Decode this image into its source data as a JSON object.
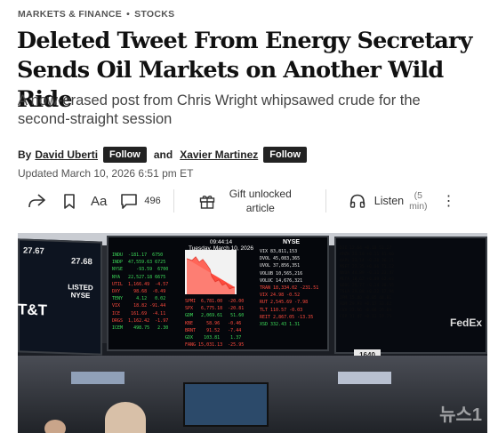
{
  "breadcrumb": {
    "section": "MARKETS & FINANCE",
    "separator": "•",
    "subsection": "STOCKS"
  },
  "headline": "Deleted Tweet From Energy Secretary Sends Oil Markets on Another Wild Ride",
  "dek": "A now-erased post from Chris Wright whipsawed crude for the second-straight session",
  "byline": {
    "by": "By",
    "author1": "David Uberti",
    "follow1": "Follow",
    "and": "and",
    "author2": "Xavier Martinez",
    "follow2": "Follow"
  },
  "updated": "Updated March 10, 2026 6:51 pm ET",
  "toolbar": {
    "aa": "Aa",
    "comments": "496",
    "gift_line1": "Gift unlocked",
    "gift_line2": "article",
    "listen": "Listen",
    "duration_line1": "(5",
    "duration_line2": "min)",
    "more": "⋮"
  },
  "photo": {
    "left_screen_top": "27.67",
    "left_screen_top2": "27.68",
    "left_screen_brand": "LISTED NYSE",
    "left_screen_logo": "T&T",
    "board_time": "09:44:14",
    "board_date": "Tuesday, March 10, 2026",
    "board_exchange": "NYSE",
    "board_left_rows": [
      "INDU  -181.17  6750",
      "INDP  47,559.63 6725",
      "NYSE     -93.59  6700",
      "NYA   22,527.18 6675",
      "UTIL  1,166.49  -4.57",
      "DXY     98.68  -0.49",
      "TENY     4.12   0.02",
      "VIX     18.82 -91.44",
      "ICE    161.69  -4.11",
      "DRGS  1,162.42  -1.97",
      "ICEM    498.75   2.30"
    ],
    "board_right_rows": [
      "VIX      83,811,153",
      "DVOL     45,083,365",
      "UVOL     37,856,351",
      "VOLUB    10,565,216",
      "VOLUC    14,676,321",
      "TRAN  18,334.02 -231.51",
      "VIX      24.98  -0.52",
      "RUT   2,545.69  -7.98",
      "TLT     110.57  -0.03",
      "REIT  2,867.05 -13.35",
      "XSD     332.43   1.31"
    ],
    "board_mid_rows": [
      "SPMI  6,781.00  -20.00",
      "SPX   6,775.18  -20.81",
      "GDM   2,069.61   51.60",
      "KBE     58.96   -0.46",
      "BRNT    91.52   -7.44",
      "GDX    103.81    1.37",
      "FANG 15,031.13  -25.95"
    ],
    "board_far_right_rows": [
      "DJI  12.64 +0.18 51.27",
      "AMZN 21.10 +0.11 41.60",
      "AAPL 33.14 -0.20 36.21",
      "MSFT 27.35 +0.06 71.12",
      "NVDA 44.89 -0.31 23.47",
      "META 18.62 +0.09 62.03",
      "GOOG 25.77 -0.14 28.55",
      "TSLA 39.08 +0.22 17.94",
      "JPM  15.40 -0.05 44.81",
      "XOM  29.93 +0.17 33.62",
      "CVX  22.56 -0.08 26.09",
      "COP  31.47 +0.13 19.75"
    ],
    "fedex": "FedEx",
    "post_number": "1640",
    "watermark": "뉴스1"
  },
  "colors": {
    "accent_dark": "#222222",
    "ticker_green": "#3ddc5a",
    "ticker_red": "#ff4a3d"
  }
}
